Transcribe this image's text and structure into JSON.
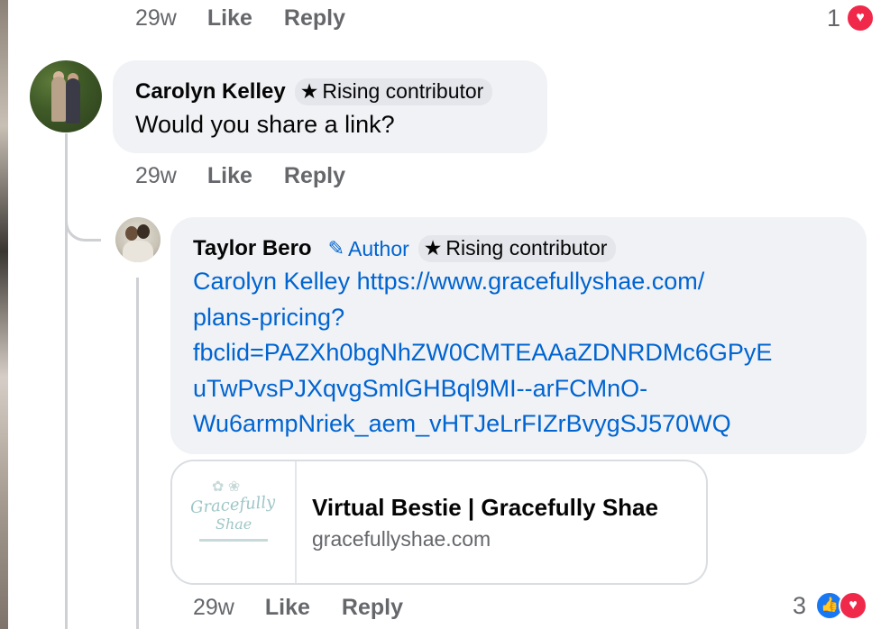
{
  "top_comment": {
    "time": "29w",
    "like_label": "Like",
    "reply_label": "Reply",
    "reaction_count": "1",
    "reaction_icons": [
      "heart-icon"
    ]
  },
  "carolyn_comment": {
    "author": "Carolyn Kelley",
    "badge": "Rising contributor",
    "text": "Would you share a link?",
    "time": "29w",
    "like_label": "Like",
    "reply_label": "Reply"
  },
  "taylor_comment": {
    "author": "Taylor Bero",
    "author_badge": "Author",
    "badge": "Rising contributor",
    "text_lines": [
      "Carolyn Kelley https://www.gracefullyshae.com/",
      "plans-pricing?",
      "fbclid=PAZXh0bgNhZW0CMTEAAaZDNRDMc6GPyE",
      "uTwPvsPJXqvgSmlGHBql9MI--arFCMnO-",
      "Wu6armpNriek_aem_vHTJeLrFIZrBvygSJ570WQ"
    ],
    "link_preview": {
      "title": "Virtual Bestie | Gracefully Shae",
      "domain": "gracefullyshae.com",
      "thumb_text_1": "Gracefully",
      "thumb_text_2": "Shae"
    },
    "time": "29w",
    "like_label": "Like",
    "reply_label": "Reply",
    "reaction_count": "3",
    "reaction_icons": [
      "like-icon",
      "heart-icon"
    ]
  },
  "colors": {
    "link": "#0064d1",
    "bubble": "#f0f2f5",
    "meta": "#65676b",
    "heart": "#f0284a",
    "like": "#1877f2"
  }
}
